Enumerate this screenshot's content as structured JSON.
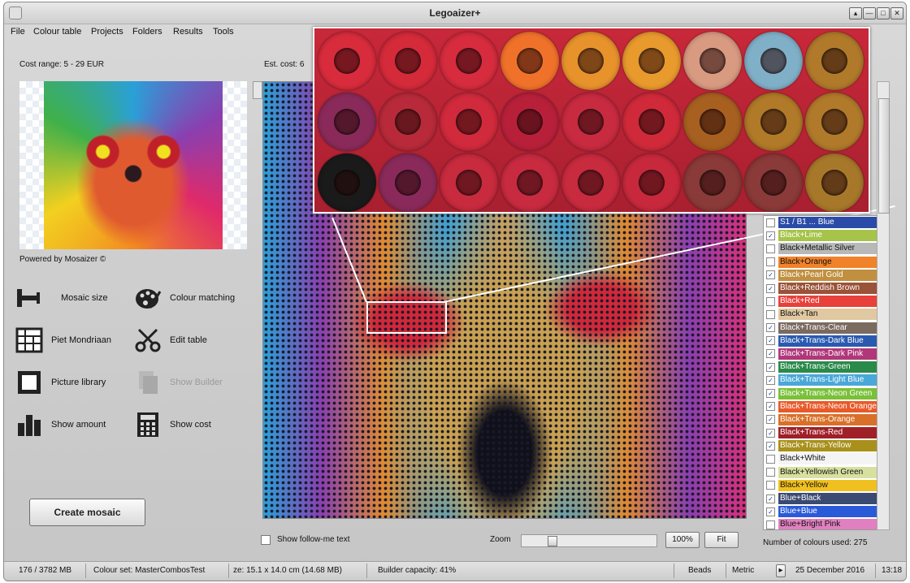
{
  "window": {
    "title": "Legoaizer+",
    "buttons": [
      "▴",
      "—",
      "□",
      "✕"
    ]
  },
  "menu": [
    "File",
    "Colour table",
    "Projects",
    "Folders",
    "Results",
    "Tools"
  ],
  "left": {
    "cost_range": "Cost range: 5 - 29 EUR",
    "powered": "Powered by Mosaizer ©",
    "est_cost": "Est. cost:  6"
  },
  "tools": [
    {
      "label": "Mosaic size",
      "icon": "ruler-icon"
    },
    {
      "label": "Colour matching",
      "icon": "palette-icon"
    },
    {
      "label": "Piet Mondriaan",
      "icon": "grid-icon"
    },
    {
      "label": "Edit table",
      "icon": "scissors-icon"
    },
    {
      "label": "Picture library",
      "icon": "picture-icon"
    },
    {
      "label": "Show Builder",
      "icon": "copy-icon"
    },
    {
      "label": "Show amount",
      "icon": "bar-chart-icon"
    },
    {
      "label": "Show cost",
      "icon": "calculator-icon"
    }
  ],
  "create_button": "Create mosaic",
  "colour_list": [
    {
      "name": "S1 / B1 ... Blue",
      "checked": false,
      "color": "#2a4ca8",
      "text": "#fff"
    },
    {
      "name": "Black+Lime",
      "checked": true,
      "color": "#a6c34a",
      "text": "#fff"
    },
    {
      "name": "Black+Metallic Silver",
      "checked": false,
      "color": "#b8b8b8",
      "text": "#111"
    },
    {
      "name": "Black+Orange",
      "checked": false,
      "color": "#f0822a",
      "text": "#111"
    },
    {
      "name": "Black+Pearl Gold",
      "checked": true,
      "color": "#c09040",
      "text": "#fff"
    },
    {
      "name": "Black+Reddish Brown",
      "checked": true,
      "color": "#9a5238",
      "text": "#fff"
    },
    {
      "name": "Black+Red",
      "checked": false,
      "color": "#e8403a",
      "text": "#fff"
    },
    {
      "name": "Black+Tan",
      "checked": false,
      "color": "#e0c8a0",
      "text": "#111"
    },
    {
      "name": "Black+Trans-Clear",
      "checked": true,
      "color": "#7a6a60",
      "text": "#fff"
    },
    {
      "name": "Black+Trans-Dark Blue",
      "checked": true,
      "color": "#2a5ab0",
      "text": "#fff"
    },
    {
      "name": "Black+Trans-Dark Pink",
      "checked": true,
      "color": "#b0387a",
      "text": "#fff"
    },
    {
      "name": "Black+Trans-Green",
      "checked": true,
      "color": "#2a8a4a",
      "text": "#fff"
    },
    {
      "name": "Black+Trans-Light Blue",
      "checked": true,
      "color": "#4aa8d8",
      "text": "#fff"
    },
    {
      "name": "Black+Trans-Neon Green",
      "checked": true,
      "color": "#7ac03a",
      "text": "#fff"
    },
    {
      "name": "Black+Trans-Neon Orange",
      "checked": true,
      "color": "#e85a2a",
      "text": "#fff"
    },
    {
      "name": "Black+Trans-Orange",
      "checked": true,
      "color": "#d8702a",
      "text": "#fff"
    },
    {
      "name": "Black+Trans-Red",
      "checked": true,
      "color": "#a02028",
      "text": "#fff"
    },
    {
      "name": "Black+Trans-Yellow",
      "checked": true,
      "color": "#a8901a",
      "text": "#fff"
    },
    {
      "name": "Black+White",
      "checked": false,
      "color": "#f4f4f4",
      "text": "#111"
    },
    {
      "name": "Black+Yellowish Green",
      "checked": false,
      "color": "#d8e0a0",
      "text": "#111"
    },
    {
      "name": "Black+Yellow",
      "checked": false,
      "color": "#f0c020",
      "text": "#111"
    },
    {
      "name": "Blue+Black",
      "checked": true,
      "color": "#3a4a70",
      "text": "#fff"
    },
    {
      "name": "Blue+Blue",
      "checked": true,
      "color": "#2a5ad8",
      "text": "#fff"
    },
    {
      "name": "Blue+Bright Pink",
      "checked": false,
      "color": "#e080c0",
      "text": "#111"
    }
  ],
  "zoom_rows": [
    [
      "#d82c3c",
      "#d42a3a",
      "#d62c3e",
      "#f0722a",
      "#e8922c",
      "#e89a2c",
      "#d89a80",
      "#80b0c8",
      "#b07a2a"
    ],
    [
      "#8a2a5a",
      "#b82a3a",
      "#d02a3c",
      "#b8203a",
      "#c82a40",
      "#d02a3a",
      "#a86020",
      "#b07a28",
      "#b07a2a"
    ],
    [
      "#1a1a1a",
      "#8a2a5a",
      "#c82a3e",
      "#c82a40",
      "#c82a3e",
      "#c8283c",
      "#8a3a38",
      "#8a3a38",
      "#a8782a"
    ]
  ],
  "bottom": {
    "follow_me": "Show follow-me text",
    "zoom_label": "Zoom",
    "btn_100": "100%",
    "btn_fit": "Fit",
    "num_colours": "Number of colours used: 275"
  },
  "status": {
    "memory": "176 / 3782 MB",
    "colour_set": "Colour set: MasterCombosTest",
    "size": "ze: 15.1 x 14.0 cm (14.68 MB)",
    "builder": "Builder capacity: 41%",
    "beads": "Beads",
    "metric": "Metric",
    "date": "25 December 2016",
    "time": "13:18",
    "arrow": "▸"
  }
}
